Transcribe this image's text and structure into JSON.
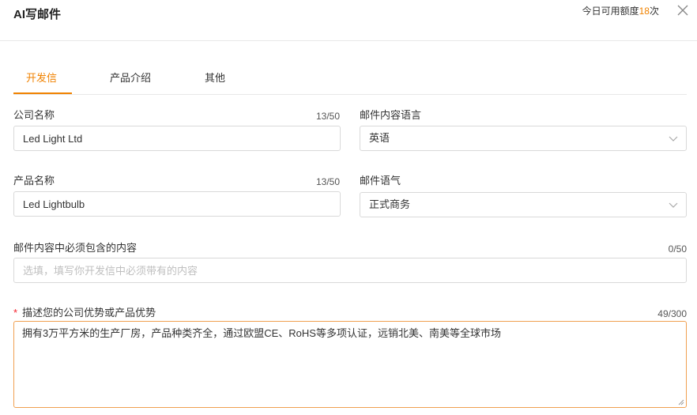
{
  "dialog": {
    "title": "AI写邮件",
    "quota_prefix": "今日可用额度",
    "quota_count": "18",
    "quota_suffix": "次"
  },
  "tabs": [
    {
      "label": "开发信",
      "active": true
    },
    {
      "label": "产品介绍",
      "active": false
    },
    {
      "label": "其他",
      "active": false
    }
  ],
  "form": {
    "company_name": {
      "label": "公司名称",
      "counter": "13/50",
      "value": "Led Light Ltd"
    },
    "product_name": {
      "label": "产品名称",
      "counter": "13/50",
      "value": "Led Lightbulb"
    },
    "email_language": {
      "label": "邮件内容语言",
      "value": "英语"
    },
    "email_tone": {
      "label": "邮件语气",
      "value": "正式商务"
    },
    "required_content": {
      "label": "邮件内容中必须包含的内容",
      "counter": "0/50",
      "placeholder": "选填，填写你开发信中必须带有的内容",
      "value": ""
    },
    "advantages": {
      "required_mark": "*",
      "label": "描述您的公司优势或产品优势",
      "counter": "49/300",
      "value": "拥有3万平方米的生产厂房，产品种类齐全，通过欧盟CE、RoHS等多项认证，远销北美、南美等全球市场"
    }
  },
  "colors": {
    "accent": "#f08200",
    "required": "#f5222d",
    "border": "#d9d9d9"
  },
  "icons": {
    "close": "close-icon",
    "select_arrow": "chevron-down-icon"
  }
}
